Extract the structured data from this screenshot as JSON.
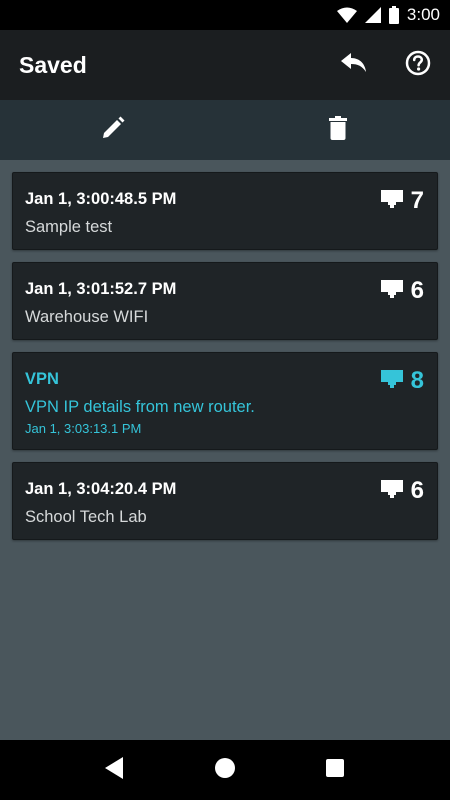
{
  "status_bar": {
    "time": "3:00"
  },
  "app_bar": {
    "title": "Saved"
  },
  "toolbar": {
    "edit_icon": "pencil-icon",
    "delete_icon": "trash-icon"
  },
  "colors": {
    "accent": "#35c4d9",
    "card_bg": "#1f2427",
    "page_bg": "#4a565c",
    "app_bar_bg": "#1b1e20",
    "toolbar_bg": "#263238"
  },
  "items": [
    {
      "title": "Jan 1, 3:00:48.5 PM",
      "description": "Sample test",
      "count": "7"
    },
    {
      "title": "Jan 1, 3:01:52.7 PM",
      "description": "Warehouse WIFI",
      "count": "6"
    },
    {
      "title": "VPN",
      "description": "VPN IP details from new router.",
      "timestamp": "Jan 1, 3:03:13.1 PM",
      "count": "8",
      "highlighted": true
    },
    {
      "title": "Jan 1, 3:04:20.4 PM",
      "description": "School Tech Lab",
      "count": "6"
    }
  ]
}
